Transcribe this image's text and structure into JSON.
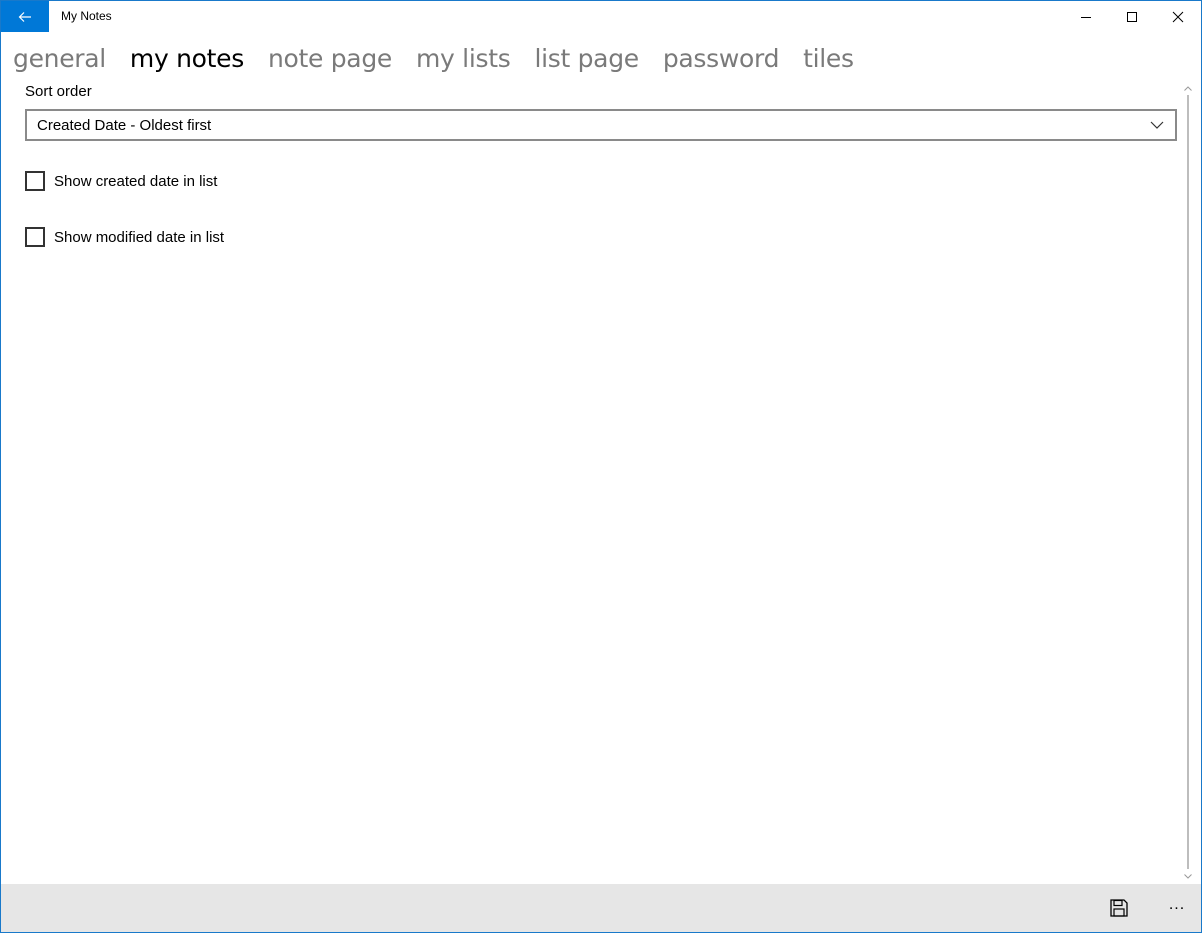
{
  "window": {
    "title": "My Notes",
    "accent_color": "#0078d7"
  },
  "caption_buttons": {
    "minimize_icon": "minimize-icon",
    "maximize_icon": "maximize-icon",
    "close_icon": "close-icon"
  },
  "pivot": {
    "items": [
      {
        "label": "general",
        "active": false
      },
      {
        "label": "my notes",
        "active": true
      },
      {
        "label": "note page",
        "active": false
      },
      {
        "label": "my lists",
        "active": false
      },
      {
        "label": "list page",
        "active": false
      },
      {
        "label": "password",
        "active": false
      },
      {
        "label": "tiles",
        "active": false
      }
    ]
  },
  "settings": {
    "sort_order_label": "Sort order",
    "sort_order_value": "Created Date - Oldest first",
    "show_created": {
      "label": "Show created date in list",
      "checked": false
    },
    "show_modified": {
      "label": "Show modified date in list",
      "checked": false
    }
  },
  "commandbar": {
    "save_icon": "save-icon",
    "more_label": "..."
  }
}
